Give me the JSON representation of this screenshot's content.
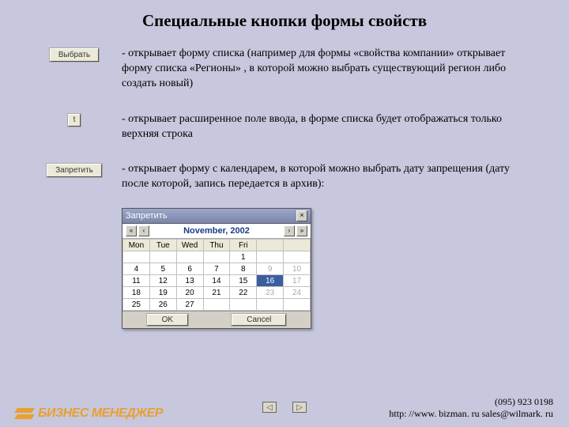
{
  "title": "Специальные кнопки формы свойств",
  "rows": [
    {
      "btn": "Выбрать",
      "desc": "- открывает форму списка (например для формы «свойства компании» открывает форму списка «Регионы» , в которой можно выбрать существующий регион либо создать новый)"
    },
    {
      "btn": "t",
      "desc": "- открывает расширенное поле ввода, в форме списка будет отображаться только верхняя строка"
    },
    {
      "btn": "Запретить",
      "desc": "- открывает форму с календарем, в которой можно выбрать дату запрещения (дату после которой, запись передается в архив):"
    }
  ],
  "calendar": {
    "window_title": "Запретить",
    "month": "November, 2002",
    "headers": [
      "Mon",
      "Tue",
      "Wed",
      "Thu",
      "Fri",
      "",
      ""
    ],
    "weeks": [
      [
        "",
        "",
        "",
        "",
        "1",
        "",
        ""
      ],
      [
        "4",
        "5",
        "6",
        "7",
        "8",
        "9",
        "10"
      ],
      [
        "11",
        "12",
        "13",
        "14",
        "15",
        "16",
        "17"
      ],
      [
        "18",
        "19",
        "20",
        "21",
        "22",
        "23",
        "24"
      ],
      [
        "25",
        "26",
        "27",
        "",
        "",
        "",
        ""
      ]
    ],
    "selected": "16",
    "ok": "OK",
    "cancel": "Cancel"
  },
  "logo_text": "БИЗНЕС МЕНЕДЖЕР",
  "contacts": {
    "phone": "(095) 923 0198",
    "line2": "http: //www. bizman. ru   sales@wilmark. ru"
  }
}
